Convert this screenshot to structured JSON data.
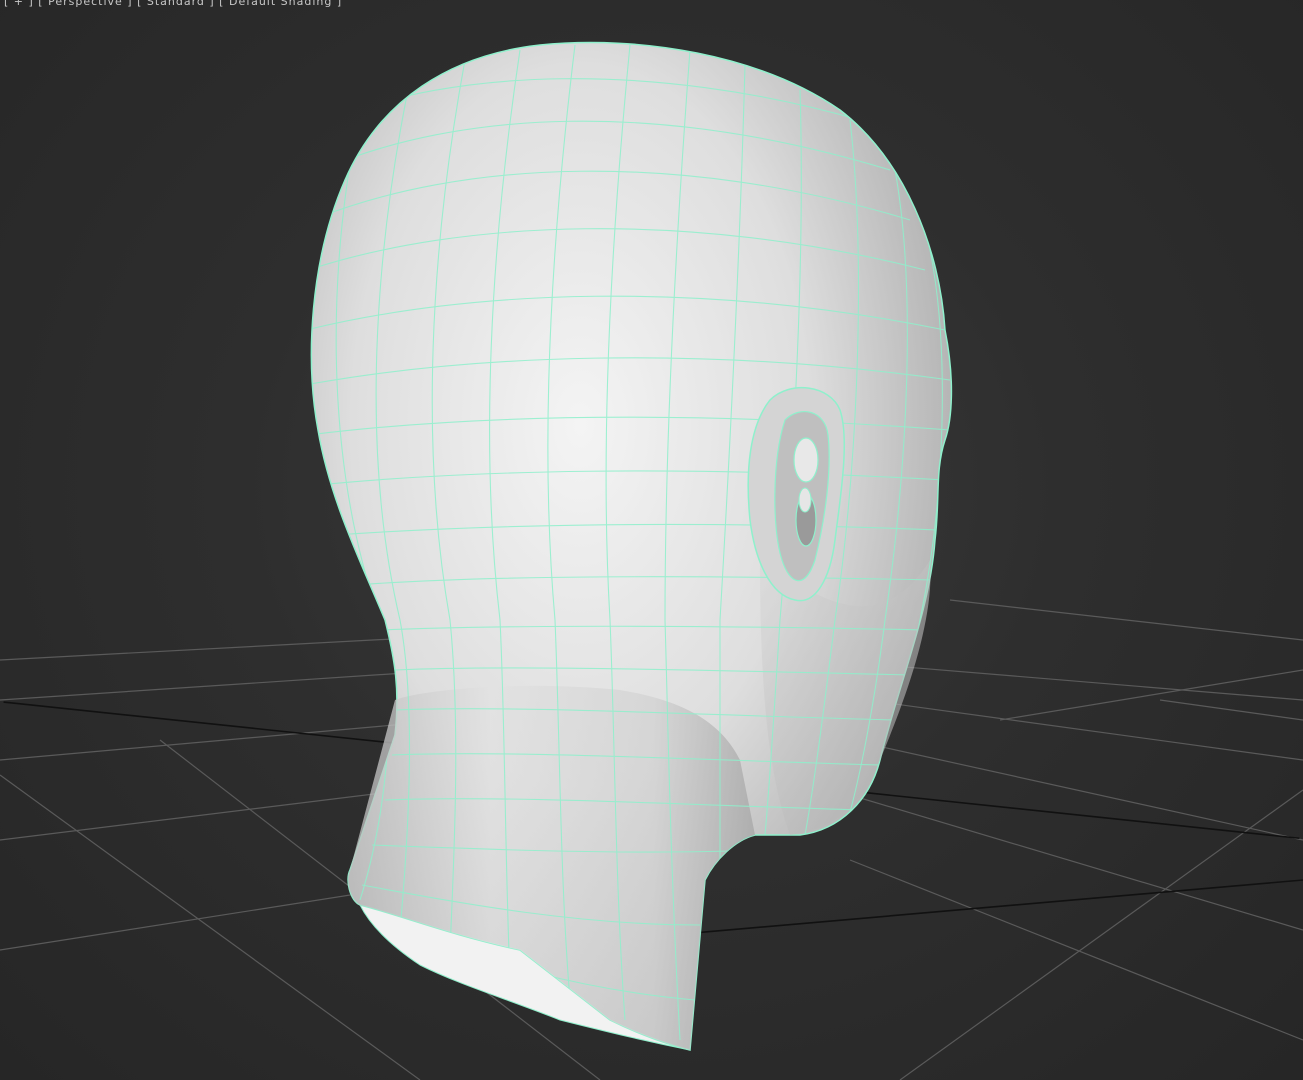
{
  "viewport": {
    "label": "[ + ] [ Perspective ] [ Standard ] [ Default Shading ]",
    "shading": "default-shading-with-edged-faces",
    "object": "head-mesh"
  },
  "colors": {
    "background": "#2b2b2b",
    "grid_line": "#5a5a5a",
    "grid_axis": "#111111",
    "mesh_surface": "#dcdcdc",
    "wireframe": "#8ff0cc"
  }
}
